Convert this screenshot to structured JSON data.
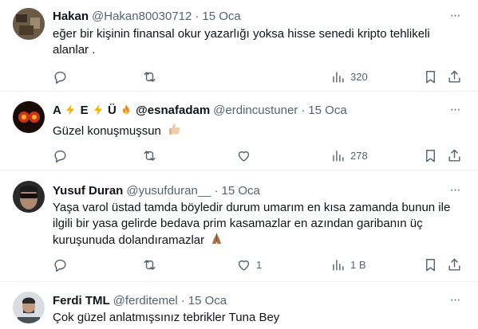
{
  "tweets": [
    {
      "name": "Hakan",
      "handle": "@Hakan80030712",
      "separator": "·",
      "date": "15 Oca",
      "text": "eğer bir kişinin finansal okur yazarlığı yoksa hisse senedi kripto tehlikeli alanlar .",
      "views": "320",
      "likes": ""
    },
    {
      "name_parts": [
        "A",
        "E",
        "Ü",
        "@esnafadam"
      ],
      "handle": "@erdincustuner",
      "separator": "·",
      "date": "15 Oca",
      "text": "Güzel konuşmuşsun",
      "views": "278",
      "likes": ""
    },
    {
      "name": "Yusuf Duran",
      "handle": "@yusufduran__",
      "separator": "·",
      "date": "15 Oca",
      "text": "Yaşa varol üstad tamda böyledir durum umarım en kısa zamanda bunun ile ilgili bir yasa gelirde bedava prim kasamazlar en azından garibanın üç kuruşunuda dolandıramazlar",
      "views": "1 B",
      "likes": "1"
    },
    {
      "name": "Ferdi TML",
      "handle": "@ferditemel",
      "separator": "·",
      "date": "15 Oca",
      "text": "Çok güzel anlatmışsınız tebrikler Tuna Bey"
    }
  ],
  "icons": {
    "reply": "reply-icon",
    "retweet": "retweet-icon",
    "like": "heart-icon",
    "views": "views-icon",
    "bookmark": "bookmark-icon",
    "share": "share-icon",
    "more": "more-icon"
  },
  "colors": {
    "text": "#0f1419",
    "secondary": "#536471",
    "divider": "#eff3f4"
  }
}
